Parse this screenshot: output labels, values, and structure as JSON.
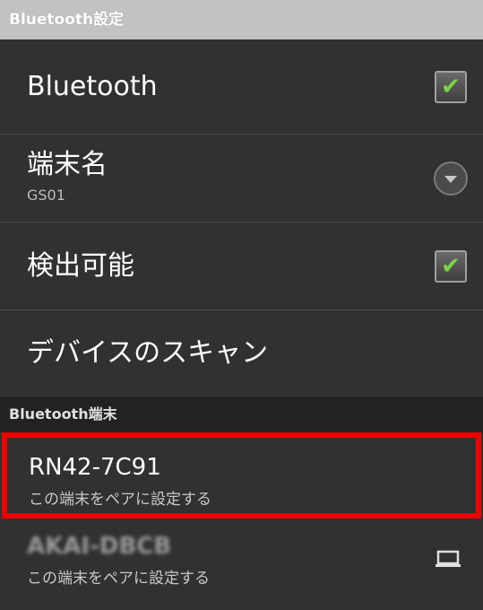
{
  "header": {
    "title": "Bluetooth設定"
  },
  "settings": [
    {
      "title": "Bluetooth",
      "control": "checkbox",
      "checked": true
    },
    {
      "title": "端末名",
      "subtitle": "GS01",
      "control": "dropdown"
    },
    {
      "title": "検出可能",
      "control": "checkbox",
      "checked": true
    },
    {
      "title": "デバイスのスキャン"
    }
  ],
  "devices_section": {
    "title": "Bluetooth端末"
  },
  "devices": [
    {
      "name": "RN42-7C91",
      "action": "この端末をペアに設定する",
      "highlighted": true,
      "highlight_color": "#ee0000"
    },
    {
      "name": "AKAI-DBCB",
      "action": "この端末をペアに設定する",
      "icon": "laptop-icon"
    }
  ],
  "colors": {
    "background": "#313131",
    "header": "#c2c2c2",
    "section": "#222222",
    "check": "#7cd34a",
    "highlight": "#ee0000"
  },
  "checkmark": "✔"
}
